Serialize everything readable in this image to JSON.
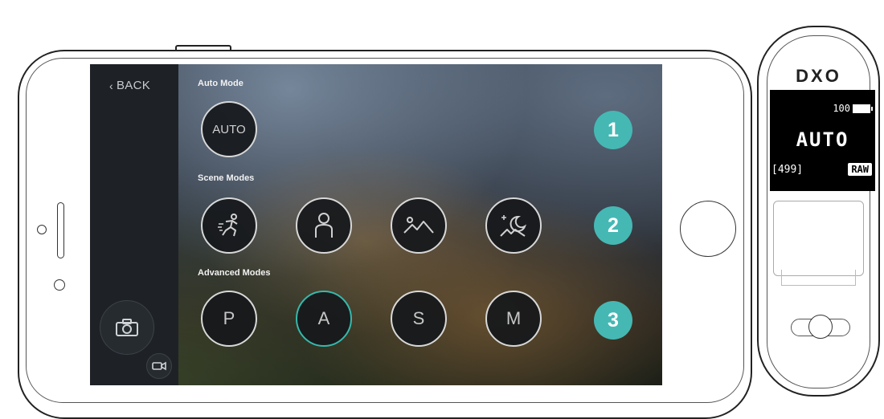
{
  "app": {
    "back_label": "BACK",
    "sections": {
      "auto": "Auto Mode",
      "scene": "Scene Modes",
      "advanced": "Advanced Modes"
    },
    "auto_button_label": "AUTO",
    "scene_modes": [
      {
        "icon": "sport-runner-icon"
      },
      {
        "icon": "portrait-person-icon"
      },
      {
        "icon": "landscape-mountain-icon"
      },
      {
        "icon": "night-moon-icon"
      }
    ],
    "advanced_modes": [
      {
        "label": "P",
        "selected": false
      },
      {
        "label": "A",
        "selected": true
      },
      {
        "label": "S",
        "selected": false
      },
      {
        "label": "M",
        "selected": false
      }
    ],
    "step_badges": [
      "1",
      "2",
      "3"
    ],
    "capture_icons": {
      "photo": "camera-icon",
      "video": "video-icon"
    },
    "accent_color": "#35b9ad",
    "badge_color": "#45b8b4"
  },
  "device": {
    "logo": "DXO",
    "battery": "100",
    "mode": "AUTO",
    "shots_remaining": "[499]",
    "format": "RAW"
  }
}
